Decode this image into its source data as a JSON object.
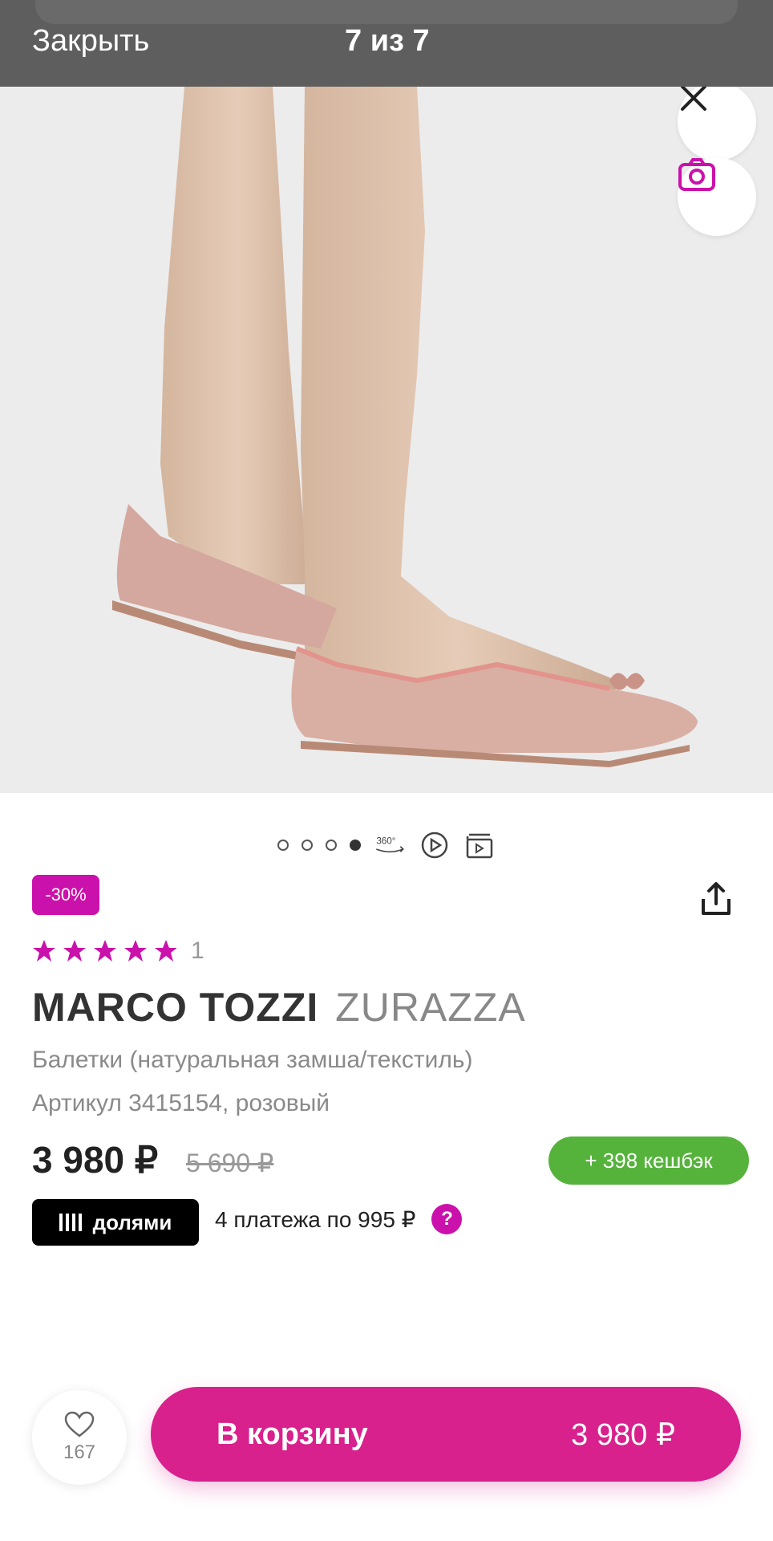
{
  "header": {
    "close_label": "Закрыть",
    "counter": "7 из 7"
  },
  "gallery": {
    "dots": 4,
    "active_dot": 3,
    "extras": [
      "360-icon",
      "play-icon",
      "card-icon"
    ],
    "extras_label_360": "360°"
  },
  "product": {
    "discount": "-30%",
    "rating_stars": 5,
    "reviews_count": "1",
    "brand": "MARCO TOZZI",
    "model": "ZURAZZA",
    "description": "Балетки (натуральная замша/текстиль)",
    "article": "Артикул 3415154, розовый",
    "price": "3 980 ₽",
    "old_price": "5 690 ₽",
    "cashback": "+ 398  кешбэк"
  },
  "dolyami": {
    "label": "долями",
    "installments": "4 платежа по 995 ₽",
    "help": "?"
  },
  "bottom": {
    "favorites_count": "167",
    "cart_label": "В корзину",
    "cart_price": "3 980 ₽"
  },
  "colors": {
    "accent": "#cb11ab",
    "cart": "#d8218c",
    "cashback": "#55b33c"
  }
}
